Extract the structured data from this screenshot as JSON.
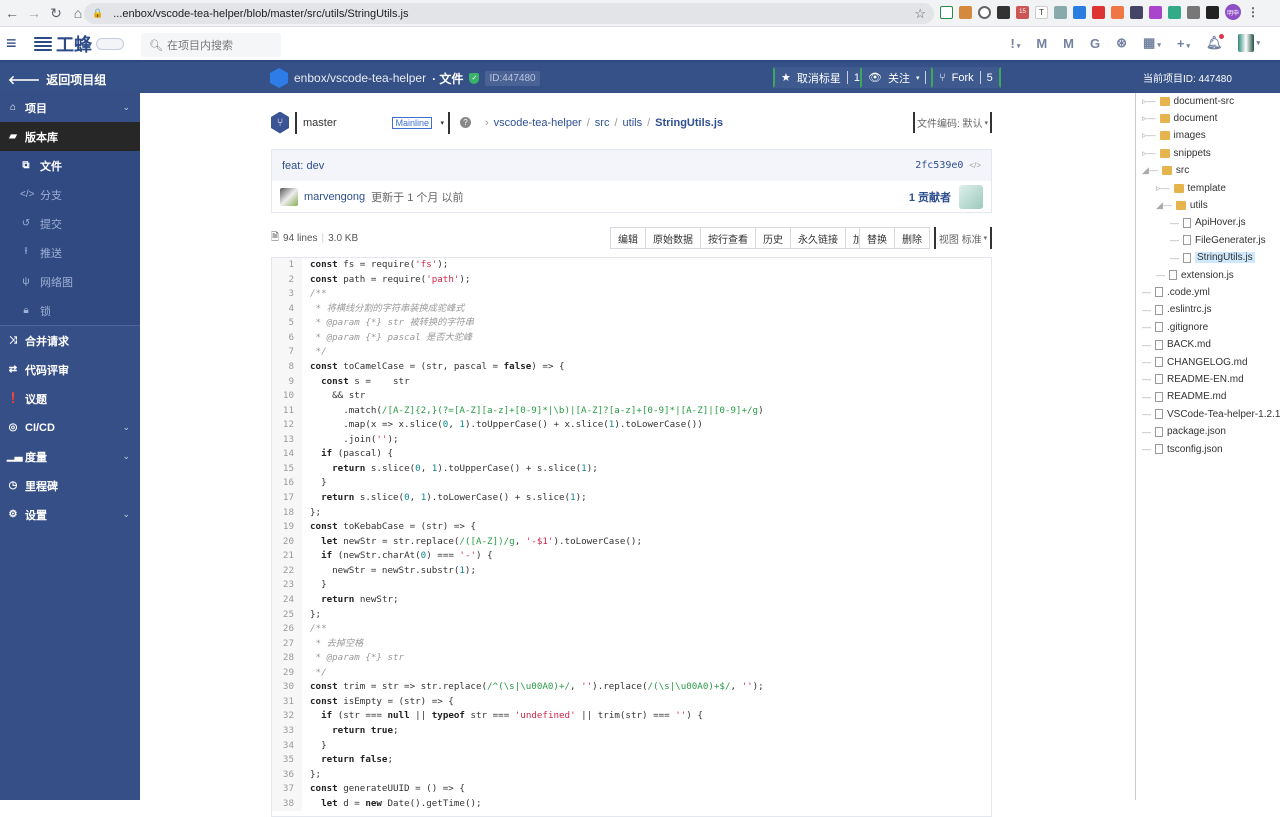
{
  "browser": {
    "url": "...enbox/vscode-tea-helper/blob/master/src/utils/StringUtils.js",
    "profile_label": "明申",
    "ext_badge": "15"
  },
  "appbar": {
    "logo_text": "工蜂",
    "search_placeholder": "在项目内搜索"
  },
  "projbar": {
    "back_label": "返回项目组",
    "project_path": "enbox/vscode-tea-helper",
    "section": "· 文件",
    "project_id": "ID:447480",
    "star": {
      "label": "取消标星",
      "count": "16"
    },
    "watch": {
      "label": "关注",
      "count": "7"
    },
    "fork": {
      "label": "Fork",
      "count": "5"
    },
    "current_project_id_label": "当前项目ID: 447480"
  },
  "sidebar": {
    "items": [
      {
        "label": "项目",
        "icon": "home-icon",
        "chevron": true
      },
      {
        "label": "版本库",
        "icon": "folder-open-icon",
        "active": true
      },
      {
        "label": "合并请求",
        "icon": "merge-icon"
      },
      {
        "label": "代码评审",
        "icon": "review-icon"
      },
      {
        "label": "议题",
        "icon": "issue-icon"
      },
      {
        "label": "CI/CD",
        "icon": "cicd-icon",
        "chevron": true
      },
      {
        "label": "度量",
        "icon": "chart-icon",
        "chevron": true
      },
      {
        "label": "里程碑",
        "icon": "clock-icon"
      },
      {
        "label": "设置",
        "icon": "gear-icon",
        "chevron": true
      }
    ],
    "subitems": [
      {
        "label": "文件",
        "icon": "files-icon",
        "active": true
      },
      {
        "label": "分支",
        "icon": "code-icon"
      },
      {
        "label": "提交",
        "icon": "history-icon"
      },
      {
        "label": "推送",
        "icon": "upload-icon"
      },
      {
        "label": "网络图",
        "icon": "network-icon"
      },
      {
        "label": "锁",
        "icon": "lock-icon"
      }
    ]
  },
  "branch": {
    "name": "master",
    "badge": "Mainline",
    "breadcrumb": [
      "vscode-tea-helper",
      "src",
      "utils",
      "StringUtils.js"
    ],
    "encoding_label": "文件编码: 默认"
  },
  "commit": {
    "message": "feat: dev",
    "sha": "2fc539e0",
    "author": "marvengong",
    "updated": "更新于 1 个月 以前",
    "contributors": "1 贡献者"
  },
  "file": {
    "lines": "94 lines",
    "size": "3.0 KB",
    "actions": [
      "编辑",
      "原始数据",
      "按行查看",
      "历史",
      "永久链接",
      "加锁"
    ],
    "actions2": [
      "替换",
      "删除"
    ],
    "view_label": "视图 标准"
  },
  "code": [
    [
      [
        "kw",
        "const"
      ],
      [
        "t",
        " fs = require("
      ],
      [
        "str",
        "'fs'"
      ],
      [
        "t",
        ");"
      ]
    ],
    [
      [
        "kw",
        "const"
      ],
      [
        "t",
        " path = require("
      ],
      [
        "str",
        "'path'"
      ],
      [
        "t",
        ");"
      ]
    ],
    [
      [
        "cm",
        "/**"
      ]
    ],
    [
      [
        "cm",
        " * 将横线分割的字符串装换成驼峰式"
      ]
    ],
    [
      [
        "cm",
        " * @param {*} str 被转换的字符串"
      ]
    ],
    [
      [
        "cm",
        " * @param {*} pascal 是否大驼峰"
      ]
    ],
    [
      [
        "cm",
        " */"
      ]
    ],
    [
      [
        "kw",
        "const"
      ],
      [
        "t",
        " toCamelCase = (str, pascal = "
      ],
      [
        "kw",
        "false"
      ],
      [
        "t",
        ") => {"
      ]
    ],
    [
      [
        "t",
        "  "
      ],
      [
        "kw",
        "const"
      ],
      [
        "t",
        " s =    str"
      ]
    ],
    [
      [
        "t",
        "    && str"
      ]
    ],
    [
      [
        "t",
        "      .match("
      ],
      [
        "rx",
        "/[A-Z]{2,}(?=[A-Z][a-z]+[0-9]*|\\b)|[A-Z]?[a-z]+[0-9]*|[A-Z]|[0-9]+/g"
      ],
      [
        "t",
        ")"
      ]
    ],
    [
      [
        "t",
        "      .map(x => x.slice("
      ],
      [
        "num",
        "0"
      ],
      [
        "t",
        ", "
      ],
      [
        "num",
        "1"
      ],
      [
        "t",
        ").toUpperCase() + x.slice("
      ],
      [
        "num",
        "1"
      ],
      [
        "t",
        ").toLowerCase())"
      ]
    ],
    [
      [
        "t",
        "      .join("
      ],
      [
        "str",
        "''"
      ],
      [
        "t",
        ");"
      ]
    ],
    [
      [
        "t",
        "  "
      ],
      [
        "kw",
        "if"
      ],
      [
        "t",
        " (pascal) {"
      ]
    ],
    [
      [
        "t",
        "    "
      ],
      [
        "kw",
        "return"
      ],
      [
        "t",
        " s.slice("
      ],
      [
        "num",
        "0"
      ],
      [
        "t",
        ", "
      ],
      [
        "num",
        "1"
      ],
      [
        "t",
        ").toUpperCase() + s.slice("
      ],
      [
        "num",
        "1"
      ],
      [
        "t",
        ");"
      ]
    ],
    [
      [
        "t",
        "  }"
      ]
    ],
    [
      [
        "t",
        "  "
      ],
      [
        "kw",
        "return"
      ],
      [
        "t",
        " s.slice("
      ],
      [
        "num",
        "0"
      ],
      [
        "t",
        ", "
      ],
      [
        "num",
        "1"
      ],
      [
        "t",
        ").toLowerCase() + s.slice("
      ],
      [
        "num",
        "1"
      ],
      [
        "t",
        ");"
      ]
    ],
    [
      [
        "t",
        "};"
      ]
    ],
    [
      [
        "kw",
        "const"
      ],
      [
        "t",
        " toKebabCase = (str) => {"
      ]
    ],
    [
      [
        "t",
        "  "
      ],
      [
        "kw",
        "let"
      ],
      [
        "t",
        " newStr = str.replace("
      ],
      [
        "rx",
        "/([A-Z])/g"
      ],
      [
        "t",
        ", "
      ],
      [
        "str",
        "'-$1'"
      ],
      [
        "t",
        ").toLowerCase();"
      ]
    ],
    [
      [
        "t",
        "  "
      ],
      [
        "kw",
        "if"
      ],
      [
        "t",
        " (newStr.charAt("
      ],
      [
        "num",
        "0"
      ],
      [
        "t",
        ") === "
      ],
      [
        "str",
        "'-'"
      ],
      [
        "t",
        ") {"
      ]
    ],
    [
      [
        "t",
        "    newStr = newStr.substr("
      ],
      [
        "num",
        "1"
      ],
      [
        "t",
        ");"
      ]
    ],
    [
      [
        "t",
        "  }"
      ]
    ],
    [
      [
        "t",
        "  "
      ],
      [
        "kw",
        "return"
      ],
      [
        "t",
        " newStr;"
      ]
    ],
    [
      [
        "t",
        "};"
      ]
    ],
    [
      [
        "cm",
        "/**"
      ]
    ],
    [
      [
        "cm",
        " * 去掉空格"
      ]
    ],
    [
      [
        "cm",
        " * @param {*} str"
      ]
    ],
    [
      [
        "cm",
        " */"
      ]
    ],
    [
      [
        "kw",
        "const"
      ],
      [
        "t",
        " trim = str => str.replace("
      ],
      [
        "rx",
        "/^(\\s|\\u00A0)+/"
      ],
      [
        "t",
        ", "
      ],
      [
        "str",
        "''"
      ],
      [
        "t",
        ").replace("
      ],
      [
        "rx",
        "/(\\s|\\u00A0)+$/"
      ],
      [
        "t",
        ", "
      ],
      [
        "str",
        "''"
      ],
      [
        "t",
        ");"
      ]
    ],
    [
      [
        "kw",
        "const"
      ],
      [
        "t",
        " isEmpty = (str) => {"
      ]
    ],
    [
      [
        "t",
        "  "
      ],
      [
        "kw",
        "if"
      ],
      [
        "t",
        " (str === "
      ],
      [
        "kw",
        "null"
      ],
      [
        "t",
        " || "
      ],
      [
        "kw",
        "typeof"
      ],
      [
        "t",
        " str === "
      ],
      [
        "str",
        "'undefined'"
      ],
      [
        "t",
        " || trim(str) === "
      ],
      [
        "str",
        "''"
      ],
      [
        "t",
        ") {"
      ]
    ],
    [
      [
        "t",
        "    "
      ],
      [
        "kw",
        "return true"
      ],
      [
        "t",
        ";"
      ]
    ],
    [
      [
        "t",
        "  }"
      ]
    ],
    [
      [
        "t",
        "  "
      ],
      [
        "kw",
        "return false"
      ],
      [
        "t",
        ";"
      ]
    ],
    [
      [
        "t",
        "};"
      ]
    ],
    [
      [
        "kw",
        "const"
      ],
      [
        "t",
        " generateUUID = () => {"
      ]
    ],
    [
      [
        "t",
        "  "
      ],
      [
        "kw",
        "let"
      ],
      [
        "t",
        " d = "
      ],
      [
        "kw",
        "new"
      ],
      [
        "t",
        " Date().getTime();"
      ]
    ]
  ],
  "tree": [
    {
      "label": "document-src",
      "type": "folder",
      "depth": 0,
      "expander": "closed"
    },
    {
      "label": "document",
      "type": "folder",
      "depth": 0,
      "expander": "closed"
    },
    {
      "label": "images",
      "type": "folder",
      "depth": 0,
      "expander": "closed"
    },
    {
      "label": "snippets",
      "type": "folder",
      "depth": 0,
      "expander": "closed"
    },
    {
      "label": "src",
      "type": "folder",
      "depth": 0,
      "expander": "open"
    },
    {
      "label": "template",
      "type": "folder",
      "depth": 1,
      "expander": "closed"
    },
    {
      "label": "utils",
      "type": "folder",
      "depth": 1,
      "expander": "open"
    },
    {
      "label": "ApiHover.js",
      "type": "file",
      "depth": 2
    },
    {
      "label": "FileGenerater.js",
      "type": "file",
      "depth": 2
    },
    {
      "label": "StringUtils.js",
      "type": "file",
      "depth": 2,
      "selected": true
    },
    {
      "label": "extension.js",
      "type": "file",
      "depth": 1
    },
    {
      "label": ".code.yml",
      "type": "file",
      "depth": 0
    },
    {
      "label": ".eslintrc.js",
      "type": "file",
      "depth": 0
    },
    {
      "label": ".gitignore",
      "type": "file",
      "depth": 0
    },
    {
      "label": "BACK.md",
      "type": "file",
      "depth": 0
    },
    {
      "label": "CHANGELOG.md",
      "type": "file",
      "depth": 0
    },
    {
      "label": "README-EN.md",
      "type": "file",
      "depth": 0
    },
    {
      "label": "README.md",
      "type": "file",
      "depth": 0
    },
    {
      "label": "VSCode-Tea-helper-1.2.1.vsix",
      "type": "file",
      "depth": 0
    },
    {
      "label": "package.json",
      "type": "file",
      "depth": 0
    },
    {
      "label": "tsconfig.json",
      "type": "file",
      "depth": 0
    }
  ]
}
